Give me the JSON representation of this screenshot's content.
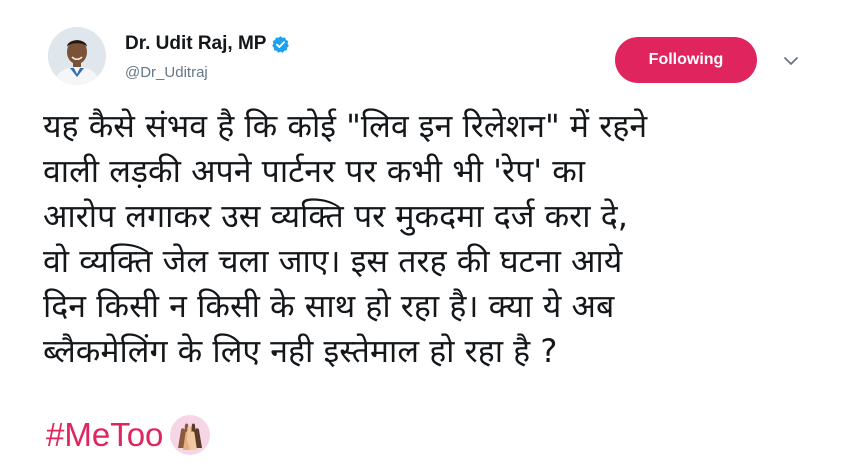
{
  "author": {
    "display_name": "Dr. Udit Raj, MP",
    "handle": "@Dr_Uditraj",
    "verified_icon": "verified-badge-icon"
  },
  "follow_button": {
    "label": "Following",
    "color": "#e0245e"
  },
  "menu": {
    "icon": "chevron-down-icon"
  },
  "tweet": {
    "lines": [
      "यह कैसे संभव है कि कोई \"लिव इन रिलेशन\" में रहने",
      "वाली लड़की अपने पार्टनर पर कभी भी 'रेप' का",
      "आरोप लगाकर उस व्यक्ति पर मुकदमा दर्ज करा दे,",
      "वो व्यक्ति जेल चला जाए। इस तरह की घटना आये",
      "दिन किसी न किसी के साथ हो रहा है। क्या ये अब",
      "ब्लैकमेलिंग के लिए नही इस्तेमाल हो रहा है ?"
    ],
    "hashtag": "#MeToo",
    "hashtag_emoji_icon": "metoo-raised-hands-icon"
  },
  "colors": {
    "accent": "#e0245e",
    "verified": "#1da1f2",
    "secondary_text": "#657786"
  }
}
